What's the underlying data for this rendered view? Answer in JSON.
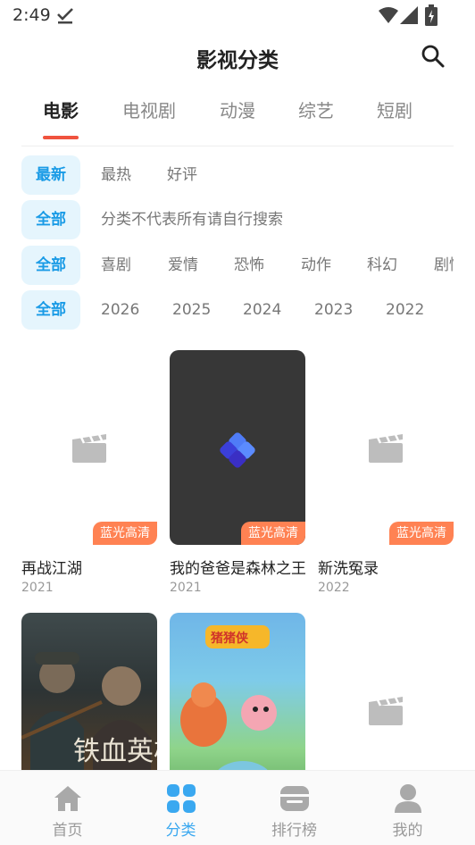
{
  "status": {
    "time": "2:49"
  },
  "header": {
    "title": "影视分类"
  },
  "tabs": [
    {
      "label": "电影",
      "active": true
    },
    {
      "label": "电视剧",
      "active": false
    },
    {
      "label": "动漫",
      "active": false
    },
    {
      "label": "综艺",
      "active": false
    },
    {
      "label": "短剧",
      "active": false
    }
  ],
  "filters": {
    "sort": {
      "selected": "最新",
      "options": [
        "最热",
        "好评"
      ]
    },
    "category": {
      "selected": "全部",
      "options": [
        "分类不代表所有请自行搜索"
      ]
    },
    "genre": {
      "selected": "全部",
      "options": [
        "喜剧",
        "爱情",
        "恐怖",
        "动作",
        "科幻",
        "剧情"
      ]
    },
    "year": {
      "selected": "全部",
      "options": [
        "2026",
        "2025",
        "2024",
        "2023",
        "2022"
      ]
    }
  },
  "movies": [
    {
      "title": "再战江湖",
      "year": "2021",
      "badge": "蓝光高清"
    },
    {
      "title": "我的爸爸是森林之王",
      "year": "2021",
      "badge": "蓝光高清"
    },
    {
      "title": "新洗冤录",
      "year": "2022",
      "badge": "蓝光高清"
    },
    {
      "poster_text": "铁血英雄"
    },
    {
      "poster_text": "猪猪侠"
    },
    {}
  ],
  "bottom_nav": [
    {
      "label": "首页",
      "icon": "home-icon",
      "active": false
    },
    {
      "label": "分类",
      "icon": "category-grid-icon",
      "active": true
    },
    {
      "label": "排行榜",
      "icon": "ranking-icon",
      "active": false
    },
    {
      "label": "我的",
      "icon": "user-icon",
      "active": false
    }
  ],
  "colors": {
    "accent": "#1a9be6",
    "tab_indicator": "#f0533e",
    "badge": "#ff8253",
    "nav_active": "#3aa8f0"
  }
}
